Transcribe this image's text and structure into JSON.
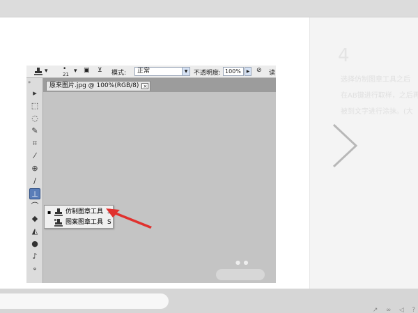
{
  "photoshop": {
    "options_bar": {
      "brush_size": "21",
      "mode_label": "模式:",
      "mode_value": "正常",
      "opacity_label": "不透明度:",
      "opacity_value": "100%",
      "overflow_text": "读"
    },
    "document_tab": {
      "title": "原来图片.jpg @ 100%(RGB/8)",
      "close": "×"
    },
    "flyout": {
      "items": [
        {
          "bullet": "▪",
          "label": "仿制图章工具",
          "shortcut": "S"
        },
        {
          "bullet": "",
          "label": "图案图章工具",
          "shortcut": "S"
        }
      ]
    },
    "toolbar_grip": "»",
    "tools": [
      "move-tool",
      "marquee-tool",
      "lasso-tool",
      "quick-selection-tool",
      "crop-tool",
      "eyedropper-tool",
      "healing-brush-tool",
      "brush-tool",
      "clone-stamp-tool",
      "history-brush-tool",
      "eraser-tool",
      "paint-bucket-tool",
      "dodge-tool",
      "pen-tool"
    ],
    "active_tool": "clone-stamp-tool"
  },
  "next_step": {
    "number": "4",
    "lines": [
      "选择仿制图章工具之后",
      "在AB键进行取样，之后再",
      "被到文字进行涂抹。(大"
    ]
  },
  "colors": {
    "accent_red": "#e0312e",
    "tool_active": "#5a7db8"
  }
}
